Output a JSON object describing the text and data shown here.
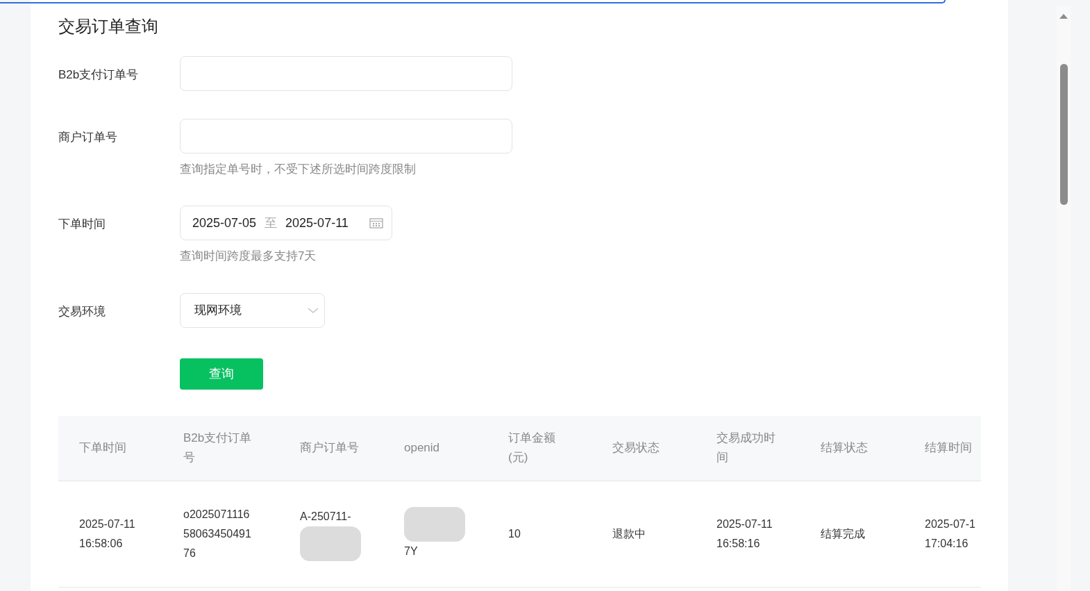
{
  "title": "交易订单查询",
  "fields": [
    {
      "kind": "text",
      "label": "B2b支付订单号"
    },
    {
      "kind": "text",
      "label": "商户订单号",
      "hint": "查询指定单号时，不受下述所选时间跨度限制"
    },
    {
      "kind": "daterange",
      "label": "下单时间",
      "start": "2025-07-05",
      "separator": "至",
      "end": "2025-07-11",
      "hint": "查询时间跨度最多支持7天"
    },
    {
      "kind": "select",
      "label": "交易环境",
      "value": "现网环境"
    }
  ],
  "query_button": "查询",
  "table": {
    "columns": [
      "下单时间",
      "B2b支付订单号",
      "商户订单号",
      "openid",
      "订单金额(元)",
      "交易状态",
      "交易成功时间",
      "结算状态",
      "结算时间"
    ],
    "rows": [
      {
        "cells": [
          {
            "lines": [
              "2025-07-11",
              "16:58:06"
            ]
          },
          {
            "lines": [
              "o2025071116",
              "58063450491",
              "76"
            ]
          },
          {
            "lines": [
              "A-250711-"
            ],
            "blurred_above": false,
            "blurred_below": true
          },
          {
            "lines": [
              "7Y"
            ],
            "blurred_above": true,
            "blurred_below": false
          },
          {
            "lines": [
              "10"
            ]
          },
          {
            "lines": [
              "退款中"
            ]
          },
          {
            "lines": [
              "2025-07-11",
              "16:58:16"
            ]
          },
          {
            "lines": [
              "结算完成"
            ]
          },
          {
            "lines": [
              "2025-07-1",
              "17:04:16"
            ]
          }
        ]
      }
    ]
  }
}
